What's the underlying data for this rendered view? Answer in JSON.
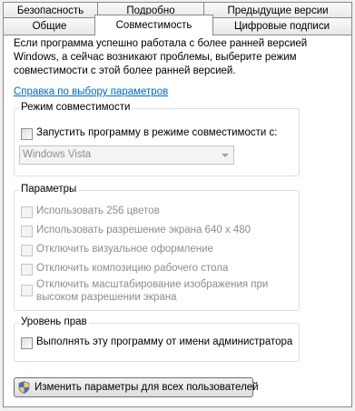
{
  "tabs_row1": [
    "Безопасность",
    "Подробно",
    "Предыдущие версии"
  ],
  "tabs_row2": [
    "Общие",
    "Совместимость",
    "Цифровые подписи"
  ],
  "description": "Если программа успешно работала с более ранней версией Windows, а сейчас возникают проблемы, выберите режим совместимости с этой более ранней версией.",
  "help_link": "Справка по выбору параметров",
  "compat_group": {
    "legend": "Режим совместимости",
    "checkbox_label": "Запустить программу в режиме совместимости с:",
    "checked": false,
    "selected_os": "Windows Vista"
  },
  "params_group": {
    "legend": "Параметры",
    "options": [
      {
        "label": "Использовать 256 цветов",
        "checked": false
      },
      {
        "label": "Использовать разрешение экрана 640 x 480",
        "checked": false
      },
      {
        "label": "Отключить визуальное оформление",
        "checked": false
      },
      {
        "label": "Отключить композицию рабочего стола",
        "checked": false
      },
      {
        "label": "Отключить масштабирование изображения при",
        "label2": "высоком разрешении экрана",
        "checked": false
      }
    ]
  },
  "rights_group": {
    "legend": "Уровень прав",
    "checkbox_label": "Выполнять эту программу от имени администратора",
    "checked": false
  },
  "all_users_button": "Изменить параметры для всех пользователей",
  "colors": {
    "link": "#0066cc",
    "disabled_text": "#8d8d8d",
    "group_border": "#d5dfe5"
  }
}
